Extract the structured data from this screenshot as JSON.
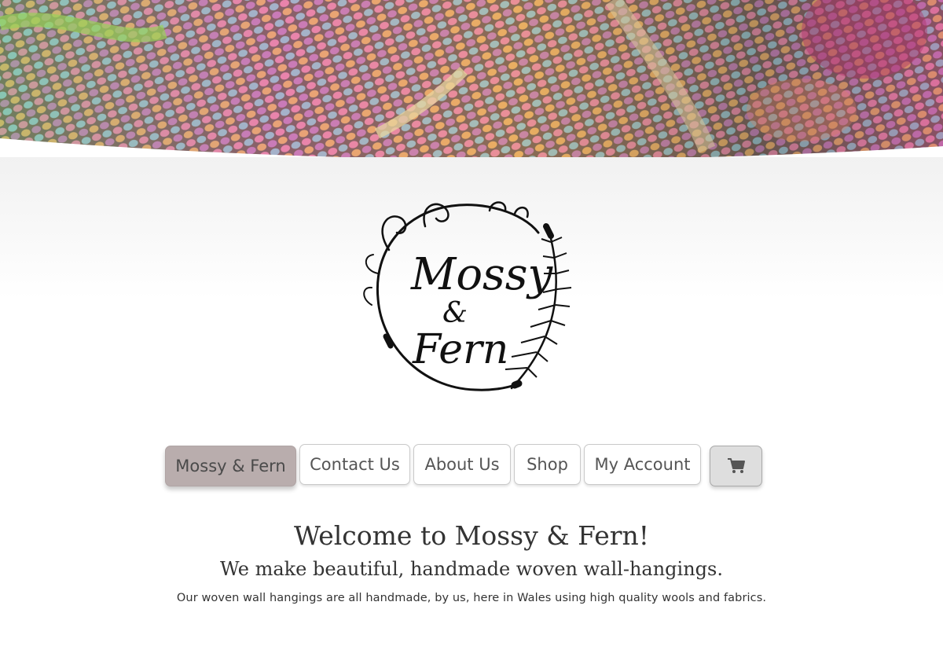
{
  "nav": {
    "items": [
      {
        "label": "Mossy & Fern"
      },
      {
        "label": "Contact Us"
      },
      {
        "label": "About Us"
      },
      {
        "label": "Shop"
      },
      {
        "label": "My Account"
      }
    ],
    "cart_icon": "shopping-cart-icon"
  },
  "logo": {
    "line1": "Mossy",
    "line2": "&",
    "line3": "Fern"
  },
  "intro": {
    "title": "Welcome to Mossy & Fern!",
    "subtitle": "We make beautiful, handmade woven wall-hangings.",
    "body": "Our woven wall hangings are all handmade, by us, here in Wales using high quality wools and fabrics."
  },
  "colors": {
    "active_nav": "#b9adad",
    "text": "#333333",
    "cart_bg": "#dedede"
  }
}
